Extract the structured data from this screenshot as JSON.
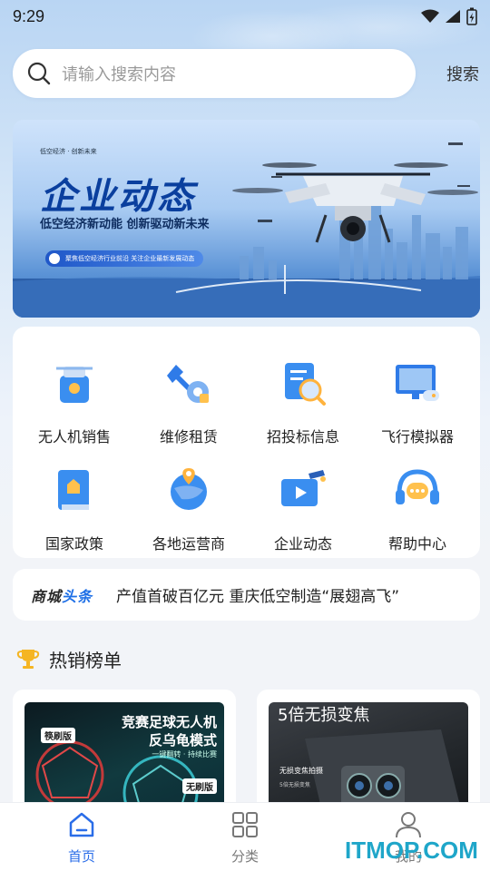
{
  "status_bar": {
    "time": "9:29"
  },
  "search": {
    "placeholder": "请输入搜索内容",
    "button_label": "搜索"
  },
  "banner": {
    "small_text": "低空经济 · 创新未来",
    "title": "企业动态",
    "subtitle": "低空经济新动能  创新驱动新未来",
    "pill_text": "聚焦低空经济行业前沿  关注企业最新发展动态"
  },
  "grid": {
    "items": [
      {
        "label": "无人机销售",
        "icon": "drone-sale-icon"
      },
      {
        "label": "维修租赁",
        "icon": "wrench-gear-icon"
      },
      {
        "label": "招投标信息",
        "icon": "document-search-icon"
      },
      {
        "label": "飞行模拟器",
        "icon": "simulator-monitor-icon"
      },
      {
        "label": "国家政策",
        "icon": "policy-book-icon"
      },
      {
        "label": "各地运营商",
        "icon": "globe-pin-icon"
      },
      {
        "label": "企业动态",
        "icon": "video-graduation-icon"
      },
      {
        "label": "帮助中心",
        "icon": "headset-chat-icon"
      }
    ]
  },
  "news": {
    "brand_prefix": "商城",
    "brand_highlight": "头条",
    "headline": "产值首破百亿元 重庆低空制造“展翅高飞”"
  },
  "hot_section": {
    "title": "热销榜单",
    "icon": "trophy-icon"
  },
  "products": [
    {
      "title_line1": "竞赛足球无人机",
      "title_line2": "反乌龟模式",
      "sub": "一键翻转 · 持续比赛",
      "badge_left": "筷刷版",
      "badge_right": "无刷版"
    },
    {
      "title": "5倍无损变焦",
      "sub": "无损变焦拍摄",
      "sub2": "5倍无损变焦"
    }
  ],
  "tabbar": {
    "tabs": [
      {
        "label": "首页",
        "icon": "home-icon",
        "active": true
      },
      {
        "label": "分类",
        "icon": "grid-icon",
        "active": false
      },
      {
        "label": "我的",
        "icon": "user-icon",
        "active": false
      }
    ]
  },
  "watermark": "ITMOP.COM",
  "colors": {
    "accent": "#2a6de8",
    "brand_blue": "#0a3f9e",
    "headline_blue": "#1e6fe6"
  }
}
